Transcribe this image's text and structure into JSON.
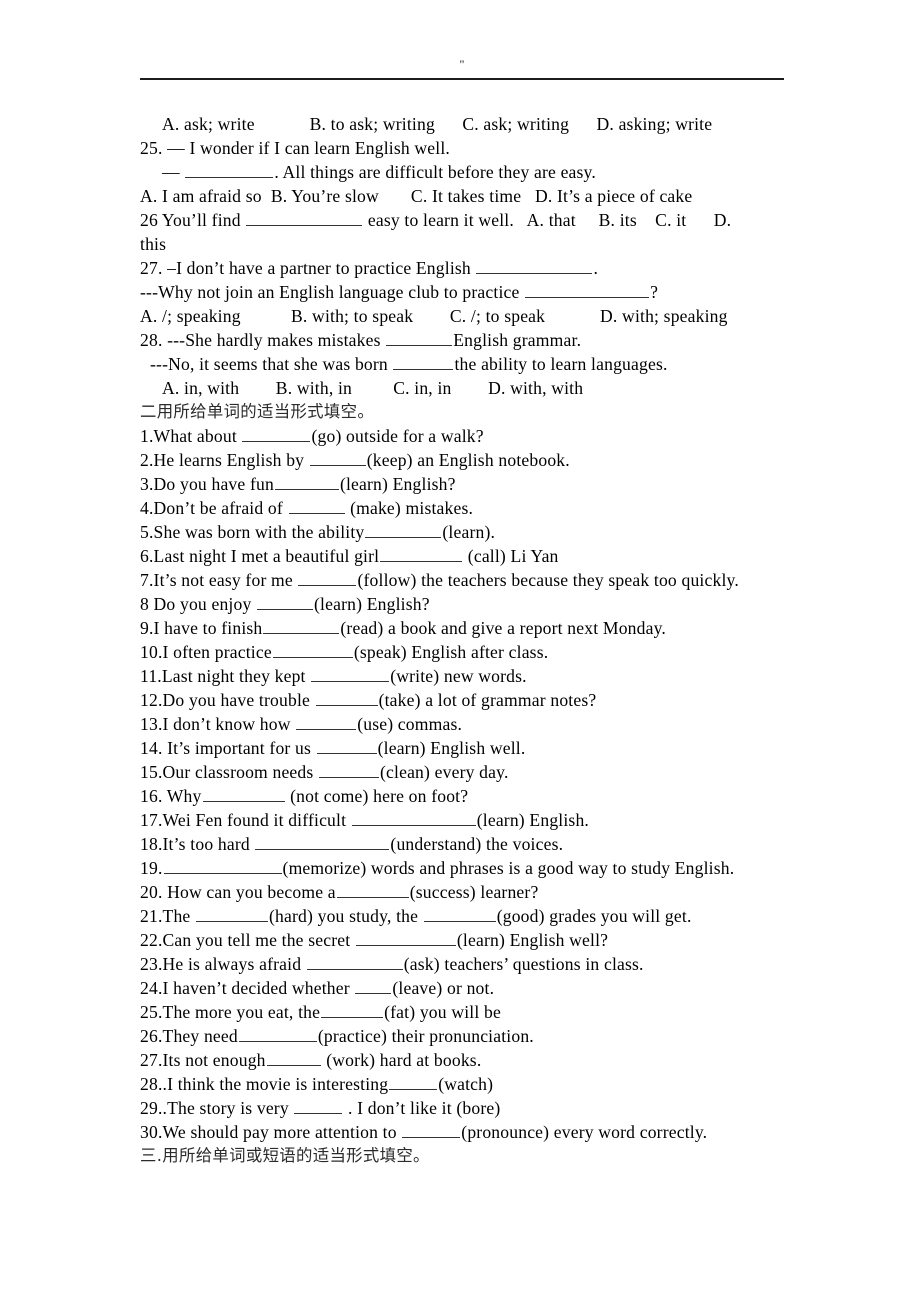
{
  "document": {
    "header_mark": "\"",
    "rule_color": "#1d1d1d"
  },
  "lines": [
    {
      "id": "opt-24",
      "text": "A. ask; write            B. to ask; writing      C. ask; writing      D. asking; write",
      "indent": "indent"
    },
    {
      "id": "q-25a",
      "text": "25. — I wonder if I can learn English well.",
      "indent": "none"
    },
    {
      "id": "q-25b",
      "pre": "— ",
      "blank": 88,
      "post": ". All things are difficult before they are easy.",
      "indent": "indent"
    },
    {
      "id": "opt-25",
      "text": "A. I am afraid so  B. You’re slow       C. It takes time   D. It’s a piece of cake",
      "indent": "none"
    },
    {
      "id": "q-26a",
      "pre": "26 You’ll find ",
      "blank": 116,
      "post": " easy to learn it well.   A. that     B. its    C. it      D.",
      "indent": "none"
    },
    {
      "id": "q-26b",
      "text": "this",
      "indent": "none"
    },
    {
      "id": "q-27a",
      "pre": "27. –I don’t have a partner to practice English ",
      "blank": 116,
      "post": ".",
      "indent": "none"
    },
    {
      "id": "q-27b",
      "pre": "---Why not join an English language club to practice ",
      "blank": 124,
      "post": "?",
      "indent": "none"
    },
    {
      "id": "opt-27",
      "text": "A. /; speaking           B. with; to speak        C. /; to speak            D. with; speaking",
      "indent": "none"
    },
    {
      "id": "q-28a",
      "pre": "28. ---She hardly makes mistakes ",
      "blank": 66,
      "post": "English grammar.",
      "indent": "none"
    },
    {
      "id": "q-28b",
      "pre": "---No, it seems that she was born ",
      "blank": 60,
      "post": "the ability to learn languages.",
      "indent": "indent-sm"
    },
    {
      "id": "opt-28",
      "text": "A. in, with        B. with, in         C. in, in        D. with, with",
      "indent": "indent"
    },
    {
      "id": "heading-2",
      "text": "二用所给单词的适当形式填空。",
      "indent": "none",
      "cn": true
    },
    {
      "id": "fill-1",
      "pre": "1.What about ",
      "blank": 68,
      "post": "(go) outside for a walk?",
      "indent": "none"
    },
    {
      "id": "fill-2",
      "pre": "2.He learns English by ",
      "blank": 56,
      "post": "(keep) an English notebook.",
      "indent": "none"
    },
    {
      "id": "fill-3",
      "pre": "3.Do you have fun",
      "blank": 64,
      "post": "(learn) English?",
      "indent": "none"
    },
    {
      "id": "fill-4",
      "pre": "4.Don’t be afraid of ",
      "blank": 56,
      "post": " (make) mistakes.",
      "indent": "none"
    },
    {
      "id": "fill-5",
      "pre": "5.She was born with the ability",
      "blank": 76,
      "post": "(learn).",
      "indent": "none"
    },
    {
      "id": "fill-6",
      "pre": "6.Last night I met a beautiful girl",
      "blank": 82,
      "post": " (call) Li Yan",
      "indent": "none"
    },
    {
      "id": "fill-7",
      "pre": "7.It’s not easy for me ",
      "blank": 58,
      "post": "(follow) the teachers because they speak too quickly.",
      "indent": "none"
    },
    {
      "id": "fill-8",
      "pre": "8 Do you enjoy ",
      "blank": 56,
      "post": "(learn) English?",
      "indent": "none"
    },
    {
      "id": "fill-9",
      "pre": "9.I have to finish",
      "blank": 76,
      "post": "(read) a book and give a report next Monday.",
      "indent": "none"
    },
    {
      "id": "fill-10",
      "pre": "10.I often practice",
      "blank": 80,
      "post": "(speak) English after class.",
      "indent": "none"
    },
    {
      "id": "fill-11",
      "pre": "11.Last night they kept ",
      "blank": 78,
      "post": "(write) new words.",
      "indent": "none"
    },
    {
      "id": "fill-12",
      "pre": "12.Do you have trouble ",
      "blank": 62,
      "post": "(take) a lot of grammar notes?",
      "indent": "none"
    },
    {
      "id": "fill-13",
      "pre": "13.I don’t know how ",
      "blank": 60,
      "post": "(use) commas.",
      "indent": "none"
    },
    {
      "id": "fill-14",
      "pre": "14. It’s important for us ",
      "blank": 60,
      "post": "(learn) English well.",
      "indent": "none"
    },
    {
      "id": "fill-15",
      "pre": "15.Our classroom needs ",
      "blank": 60,
      "post": "(clean) every day.",
      "indent": "none"
    },
    {
      "id": "fill-16",
      "pre": "16. Why",
      "blank": 82,
      "post": " (not come) here on foot?",
      "indent": "none"
    },
    {
      "id": "fill-17",
      "pre": "17.Wei Fen found it difficult ",
      "blank": 124,
      "post": "(learn) English.",
      "indent": "none"
    },
    {
      "id": "fill-18",
      "pre": "18.It’s too hard ",
      "blank": 134,
      "post": "(understand) the voices.",
      "indent": "none"
    },
    {
      "id": "fill-19",
      "pre": "19.",
      "blank": 118,
      "post": "(memorize) words and phrases is a good way to study English.",
      "indent": "none"
    },
    {
      "id": "fill-20",
      "pre": "20. How can you become a",
      "blank": 72,
      "post": "(success) learner?",
      "indent": "none"
    },
    {
      "id": "fill-21",
      "pre": "21.The ",
      "blank": 72,
      "post": "(hard) you study, the ",
      "blank2": 72,
      "post2": "(good) grades you will get.",
      "indent": "none"
    },
    {
      "id": "fill-22",
      "pre": "22.Can you tell me the secret ",
      "blank": 100,
      "post": "(learn) English well?",
      "indent": "none"
    },
    {
      "id": "fill-23",
      "pre": "23.He is always afraid ",
      "blank": 96,
      "post": "(ask) teachers’ questions in class.",
      "indent": "none"
    },
    {
      "id": "fill-24",
      "pre": "24.I haven’t decided whether ",
      "blank": 36,
      "post": "(leave) or not.",
      "indent": "none"
    },
    {
      "id": "fill-25",
      "pre": "25.The more you eat, the",
      "blank": 62,
      "post": "(fat) you will be",
      "indent": "none"
    },
    {
      "id": "fill-26",
      "pre": "26.They need",
      "blank": 78,
      "post": "(practice) their pronunciation.",
      "indent": "none"
    },
    {
      "id": "fill-27",
      "pre": "27.Its not enough",
      "blank": 54,
      "post": " (work) hard at books.",
      "indent": "none"
    },
    {
      "id": "fill-28",
      "pre": "28..I think the movie is interesting",
      "blank": 48,
      "post": "(watch)",
      "indent": "none"
    },
    {
      "id": "fill-29",
      "pre": "29..The story is very ",
      "blank": 48,
      "post": " . I don’t like it (bore)",
      "indent": "none"
    },
    {
      "id": "fill-30",
      "pre": "30.We should pay more attention to ",
      "blank": 58,
      "post": "(pronounce) every word correctly.",
      "indent": "none"
    },
    {
      "id": "heading-3",
      "text": "三.用所给单词或短语的适当形式填空。",
      "indent": "none",
      "cn": true
    }
  ]
}
